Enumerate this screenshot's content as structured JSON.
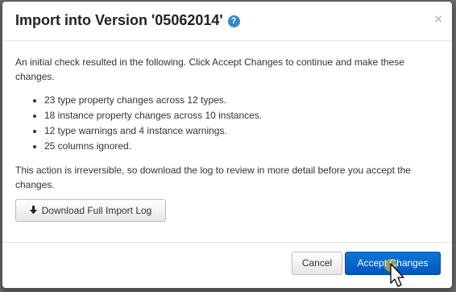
{
  "dialog": {
    "title": "Import into Version '05062014'",
    "help_icon": "question-circle-icon",
    "help_glyph": "?",
    "close_icon": "close-icon",
    "close_glyph": "×"
  },
  "body": {
    "intro": "An initial check resulted in the following. Click Accept Changes to continue and make these changes.",
    "items": [
      "23 type property changes across 12 types.",
      "18 instance property changes across 10 instances.",
      "12 type warnings and 4 instance warnings.",
      "25 columns ignored."
    ],
    "warning": "This action is irreversible, so download the log to review in more detail before you accept the changes."
  },
  "buttons": {
    "download_label": "Download Full Import Log",
    "download_icon": "download-arrow-icon",
    "cancel_label": "Cancel",
    "accept_label": "Accept Changes"
  },
  "colors": {
    "primary": "#0a6fcf",
    "help_icon": "#3a87c8",
    "overlay": "#6e6e6e"
  }
}
